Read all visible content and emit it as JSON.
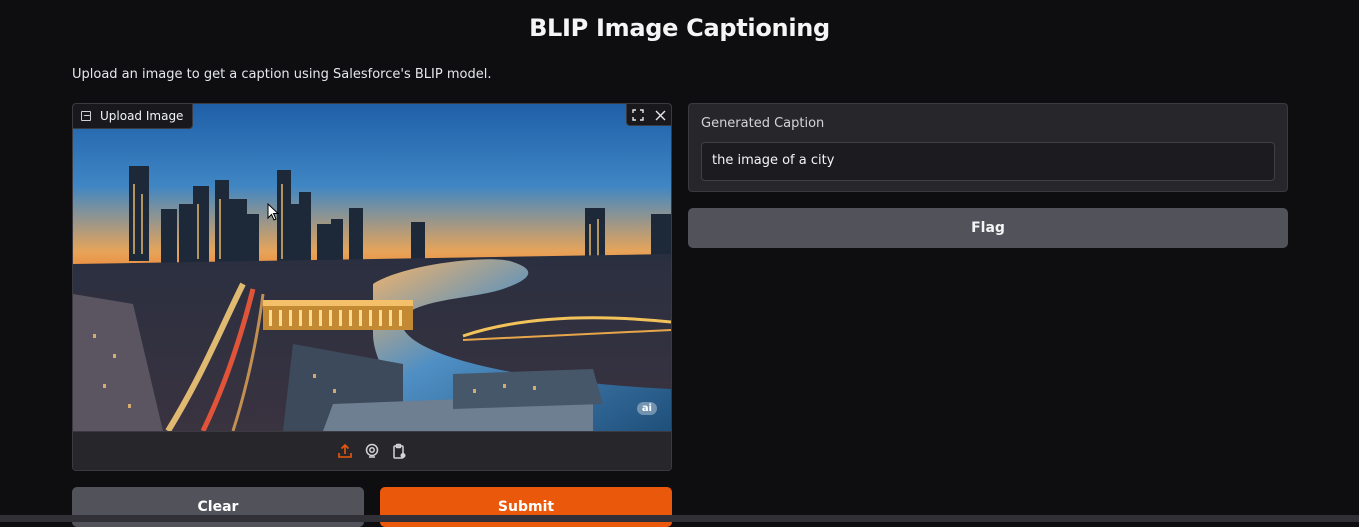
{
  "app": {
    "title": "BLIP Image Captioning",
    "description": "Upload an image to get a caption using Salesforce's BLIP model."
  },
  "image_input": {
    "label": "Upload Image",
    "label_icon": "image-icon",
    "fullscreen_icon": "fullscreen-icon",
    "close_icon": "close-icon",
    "badge": "ai",
    "toolbar_icons": [
      "upload-icon",
      "webcam-icon",
      "clipboard-icon"
    ],
    "accent_color": "#ea580c"
  },
  "output": {
    "label": "Generated Caption",
    "value": "the image of a city"
  },
  "buttons": {
    "flag": "Flag",
    "clear": "Clear",
    "submit": "Submit"
  },
  "colors": {
    "background": "#0e0e11",
    "primary": "#ea580c",
    "secondary": "#52525b"
  }
}
